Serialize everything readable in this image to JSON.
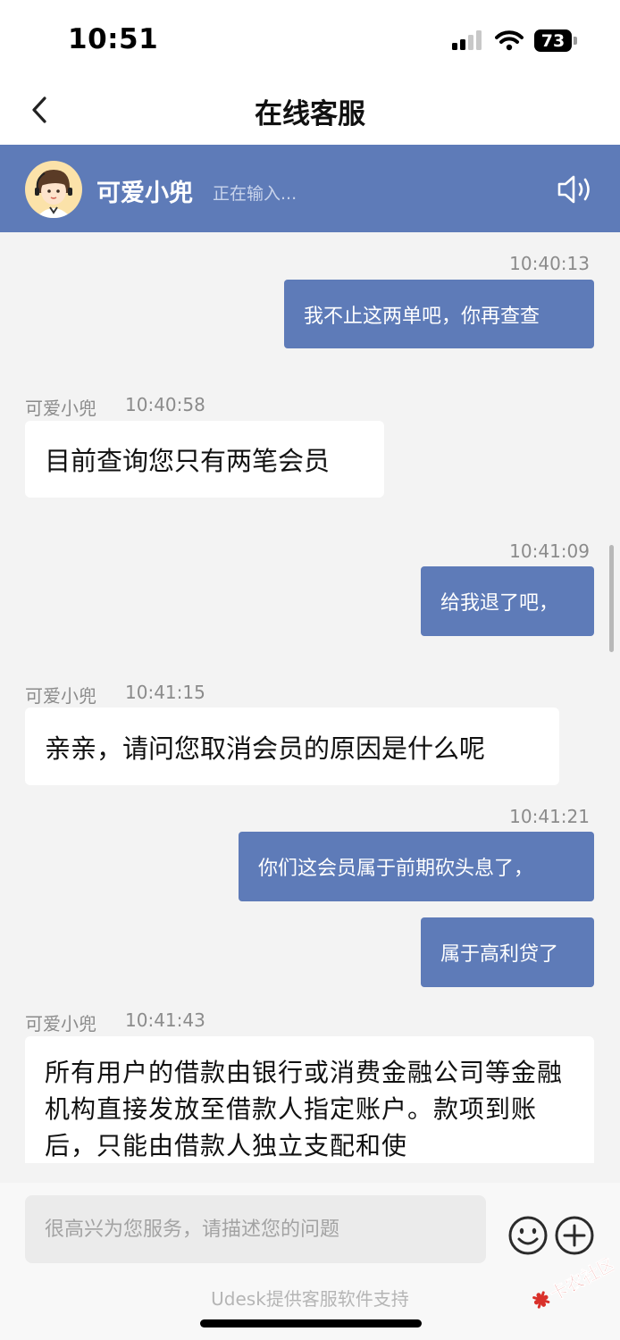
{
  "status_bar": {
    "time": "10:51",
    "battery": "73"
  },
  "nav": {
    "title": "在线客服"
  },
  "agent": {
    "name": "可爱小兜",
    "status": "正在输入..."
  },
  "messages": [
    {
      "from": "user",
      "time": "10:40:13",
      "text": "我不止这两单吧，你再查查"
    },
    {
      "from": "agent",
      "sender": "可爱小兜",
      "time": "10:40:58",
      "text": "目前查询您只有两笔会员"
    },
    {
      "from": "user",
      "time": "10:41:09",
      "text": "给我退了吧，"
    },
    {
      "from": "agent",
      "sender": "可爱小兜",
      "time": "10:41:15",
      "text": "亲亲，请问您取消会员的原因是什么呢"
    },
    {
      "from": "user",
      "time": "10:41:21",
      "text": "你们这会员属于前期砍头息了，"
    },
    {
      "from": "user",
      "time": "",
      "text": "属于高利贷了"
    },
    {
      "from": "agent",
      "sender": "可爱小兜",
      "time": "10:41:43",
      "text": "所有用户的借款由银行或消费金融公司等金融机构直接发放至借款人指定账户。款项到账后，只能由借款人独立支配和使"
    }
  ],
  "input": {
    "placeholder": "很高兴为您服务，请描述您的问题"
  },
  "footer": {
    "powered_by": "Udesk提供客服软件支持"
  },
  "watermark": {
    "text": "卡农社区"
  },
  "colors": {
    "accent": "#5e7bb8",
    "background": "#f3f3f3"
  }
}
